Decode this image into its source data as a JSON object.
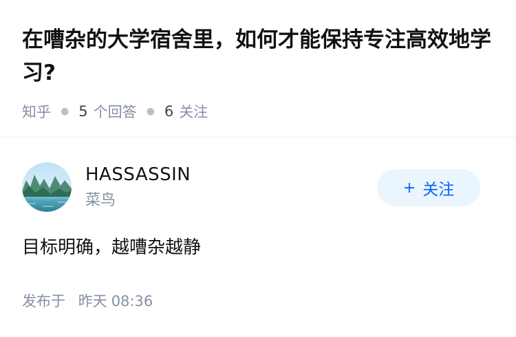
{
  "question": {
    "title": "在嘈杂的大学宿舍里，如何才能保持专注高效地学习?",
    "source": "知乎",
    "answers_count": "5",
    "answers_label": "个回答",
    "followers_count": "6",
    "followers_label": "关注"
  },
  "answer": {
    "author": {
      "name": "HASSASSIN",
      "badge": "菜鸟",
      "avatar_icon": "landscape-avatar"
    },
    "follow_button": {
      "icon": "+",
      "label": "关注"
    },
    "content": "目标明确，越嘈杂越静",
    "published_label": "发布于",
    "published_day": "昨天",
    "published_time": "08:36"
  },
  "colors": {
    "accent": "#0066ff",
    "accent_bg": "#ebf5fd",
    "muted_text": "#8590a6",
    "primary_text": "#121212"
  }
}
